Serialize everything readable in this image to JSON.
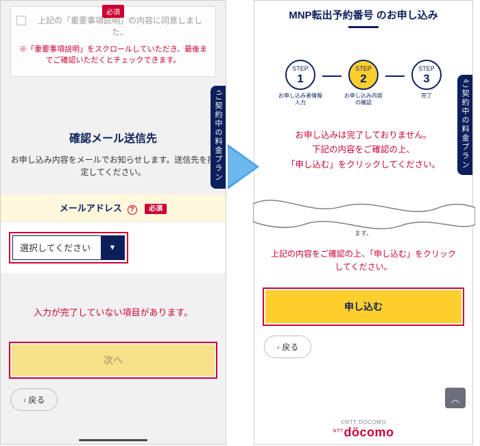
{
  "left": {
    "consent": {
      "required_badge": "必須",
      "checkbox_label": "上記の「重要事項説明」の内容に同意しました。",
      "scroll_note": "※「重要事項説明」をスクロールしていただき、最後までご確認いただくとチェックできます。"
    },
    "side_tab": "ご契約中の料金プラン",
    "section_title": "確認メール送信先",
    "section_sub": "お申し込み内容をメールでお知らせします。送信先を指定してください。",
    "mail_header": {
      "label": "メールアドレス",
      "help": "?",
      "required_badge": "必須"
    },
    "select_placeholder": "選択してください",
    "select_caret": "▼",
    "incomplete_warning": "入力が完了していない項目があります。",
    "next_label": "次へ",
    "back_label": "戻る"
  },
  "right": {
    "title": "MNP転出予約番号 のお申し込み",
    "steps": [
      {
        "top": "STEP",
        "num": "1",
        "label": "お申し込み者情報\n入力"
      },
      {
        "top": "STEP",
        "num": "2",
        "label": "お申し込み内容\nの確認"
      },
      {
        "top": "STEP",
        "num": "3",
        "label": "完了"
      }
    ],
    "side_tab": "ご契約中の料金プラン",
    "warn_lines": "お申し込みは完了しておりません。\n下記の内容をご確認の上、\n「申し込む」をクリックしてください。",
    "truncated_fragment": "ます。",
    "confirm_note": "上記の内容をご確認の上、「申し込む」をクリックしてください。",
    "apply_label": "申し込む",
    "back_label": "戻る",
    "footer_copyright": "©NTT DOCOMO",
    "footer_logo_sup": "NTT",
    "footer_logo": "döcomo",
    "top_caret": "︿"
  }
}
